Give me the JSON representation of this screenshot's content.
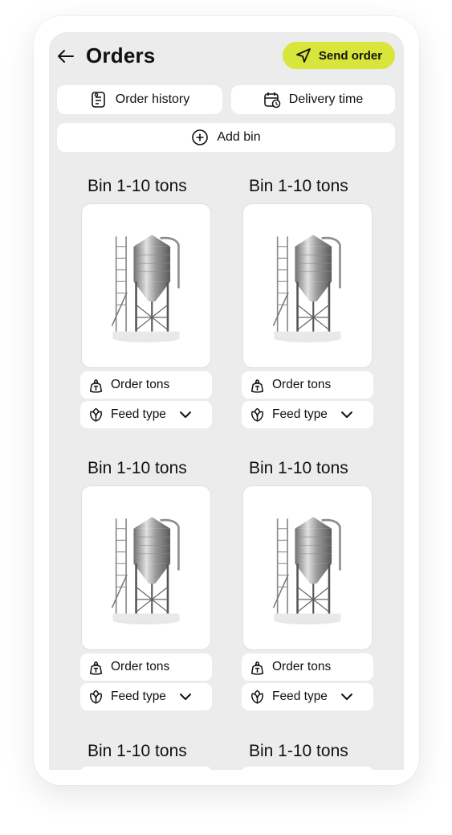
{
  "header": {
    "title": "Orders",
    "send_label": "Send order"
  },
  "actions": {
    "history_label": "Order history",
    "delivery_label": "Delivery time",
    "add_bin_label": "Add bin"
  },
  "bins": [
    {
      "title": "Bin 1-10 tons",
      "order_label": "Order tons",
      "feed_label": "Feed type"
    },
    {
      "title": "Bin 1-10 tons",
      "order_label": "Order tons",
      "feed_label": "Feed type"
    },
    {
      "title": "Bin 1-10 tons",
      "order_label": "Order tons",
      "feed_label": "Feed type"
    },
    {
      "title": "Bin 1-10 tons",
      "order_label": "Order tons",
      "feed_label": "Feed type"
    },
    {
      "title": "Bin 1-10 tons"
    },
    {
      "title": "Bin 1-10 tons"
    }
  ],
  "colors": {
    "accent": "#d8e53a",
    "screen_bg": "#ececec"
  }
}
